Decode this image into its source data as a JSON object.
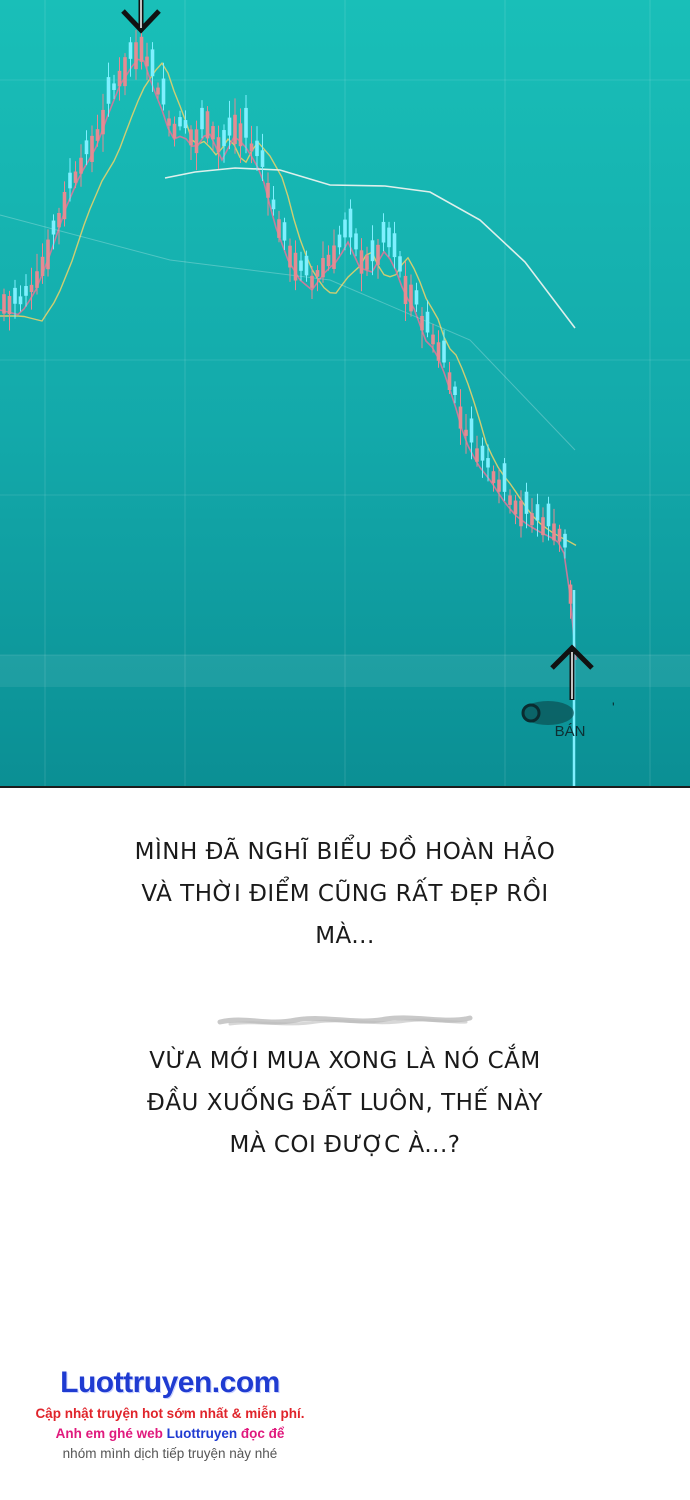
{
  "chart_panel": {
    "sell_marker_label": "BÁN",
    "colors": {
      "background_top": "#19bfb8",
      "background_bottom": "#0b8f94",
      "candle_up": "#7ff0ff",
      "candle_down": "#e58b92",
      "ma_short": "#d9779a",
      "ma_mid": "#e3d06b",
      "ma_long": "#f4f6f2"
    },
    "icons": [
      "down-arrow-icon",
      "up-arrow-icon"
    ]
  },
  "speech_bubbles": [
    {
      "lines": [
        "Mình đã nghĩ biểu đồ hoàn hảo",
        "và thời điểm cũng rất đẹp rồi",
        "mà..."
      ]
    },
    {
      "lines": [
        "Vừa mới mua xong là nó cắm",
        "đầu xuống đất luôn, thế này",
        "mà coi được à...?"
      ]
    }
  ],
  "watermark": {
    "site": "Luottruyen.com",
    "line1": "Cập nhật truyện hot sớm nhất & miễn phí.",
    "line2_prefix": "Anh em ghé web ",
    "line2_site": "Luottruyen",
    "line2_suffix": " đọc để",
    "line3": "nhóm mình dịch tiếp truyện này nhé"
  }
}
